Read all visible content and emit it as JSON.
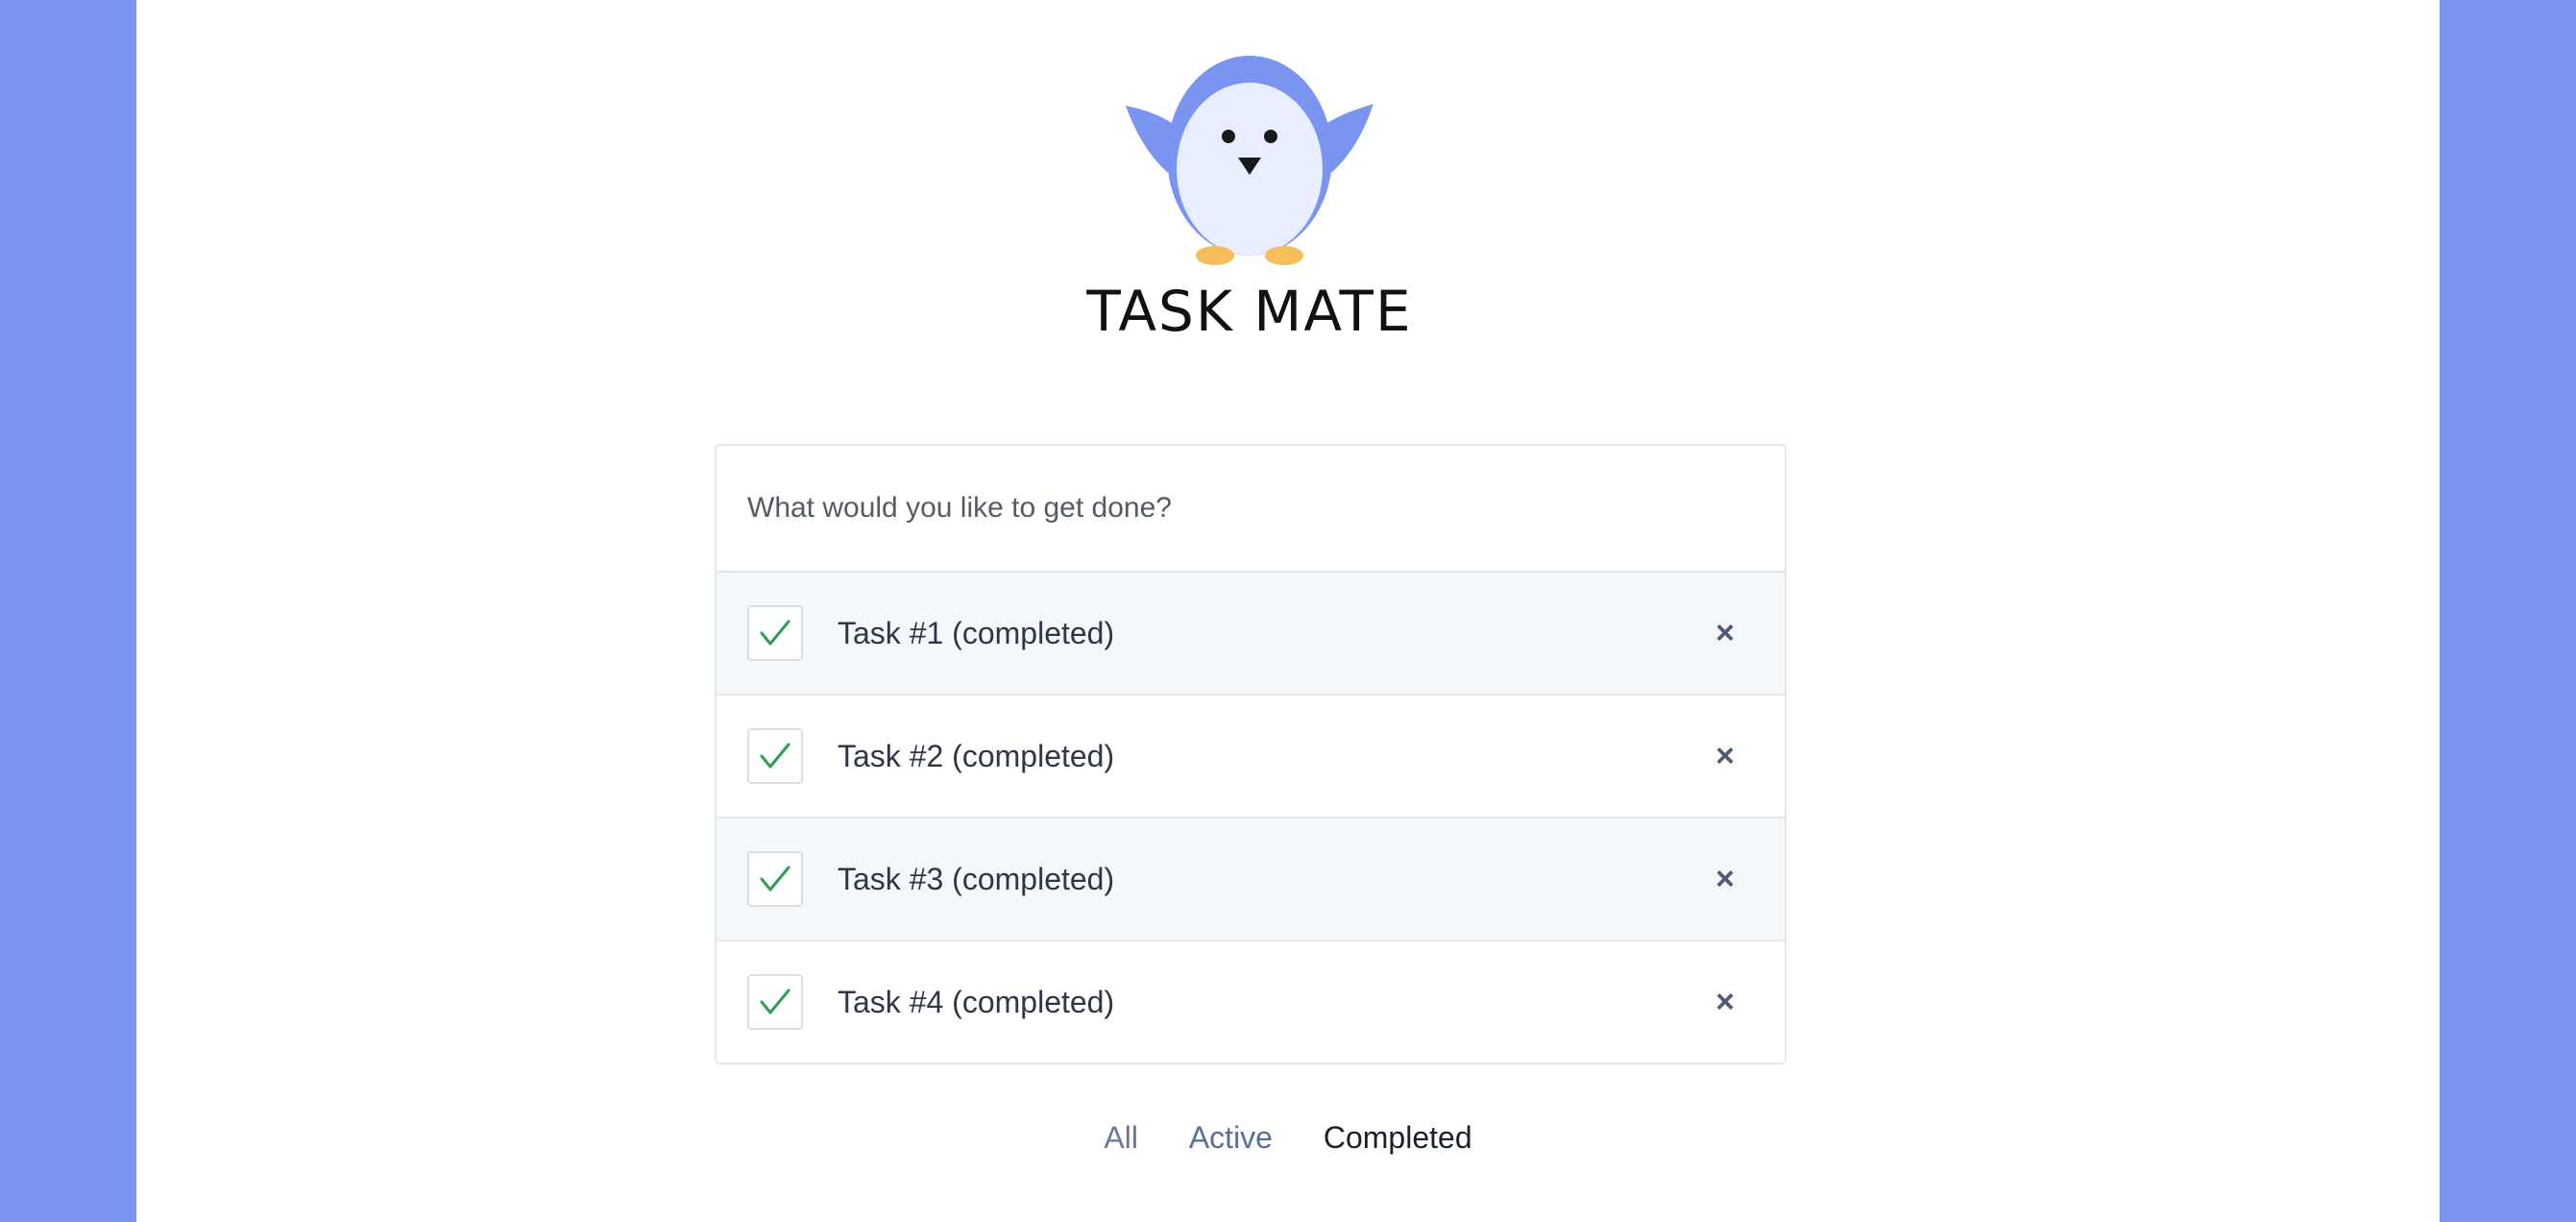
{
  "app": {
    "title": "TASK MATE",
    "logo_icon": "penguin-icon"
  },
  "colors": {
    "background_accent": "#7a95f0",
    "penguin_body": "#7a95f0",
    "penguin_belly": "#e8edff",
    "penguin_feet": "#f6bd5b",
    "check_color": "#2f9e55"
  },
  "new_task": {
    "placeholder": "What would you like to get done?",
    "value": ""
  },
  "tasks": [
    {
      "label": "Task #1 (completed)",
      "completed": true
    },
    {
      "label": "Task #2 (completed)",
      "completed": true
    },
    {
      "label": "Task #3 (completed)",
      "completed": true
    },
    {
      "label": "Task #4 (completed)",
      "completed": true
    }
  ],
  "task_icons": {
    "check": "check-icon",
    "delete": "close-icon",
    "delete_glyph": "×"
  },
  "filters": {
    "all": "All",
    "active": "Active",
    "completed": "Completed",
    "selected": "Completed"
  }
}
